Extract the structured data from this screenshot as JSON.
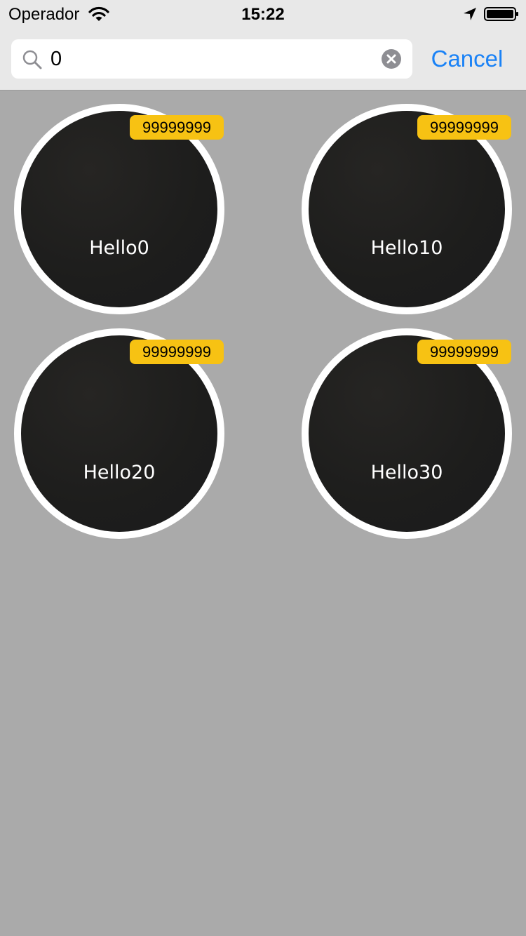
{
  "status_bar": {
    "carrier": "Operador",
    "time": "15:22"
  },
  "search": {
    "query": "0",
    "cancel_label": "Cancel"
  },
  "results": [
    {
      "title": "Hello0",
      "badge": "99999999"
    },
    {
      "title": "Hello10",
      "badge": "99999999"
    },
    {
      "title": "Hello20",
      "badge": "99999999"
    },
    {
      "title": "Hello30",
      "badge": "99999999"
    }
  ],
  "colors": {
    "accent": "#1a82f6",
    "badge": "#f7c213",
    "background": "#aaaaaa",
    "cell": "#1d1d1c"
  },
  "icons": {
    "wifi": "wifi-icon",
    "location": "location-arrow-icon",
    "battery": "battery-icon",
    "search": "search-icon",
    "clear": "clear-icon"
  }
}
